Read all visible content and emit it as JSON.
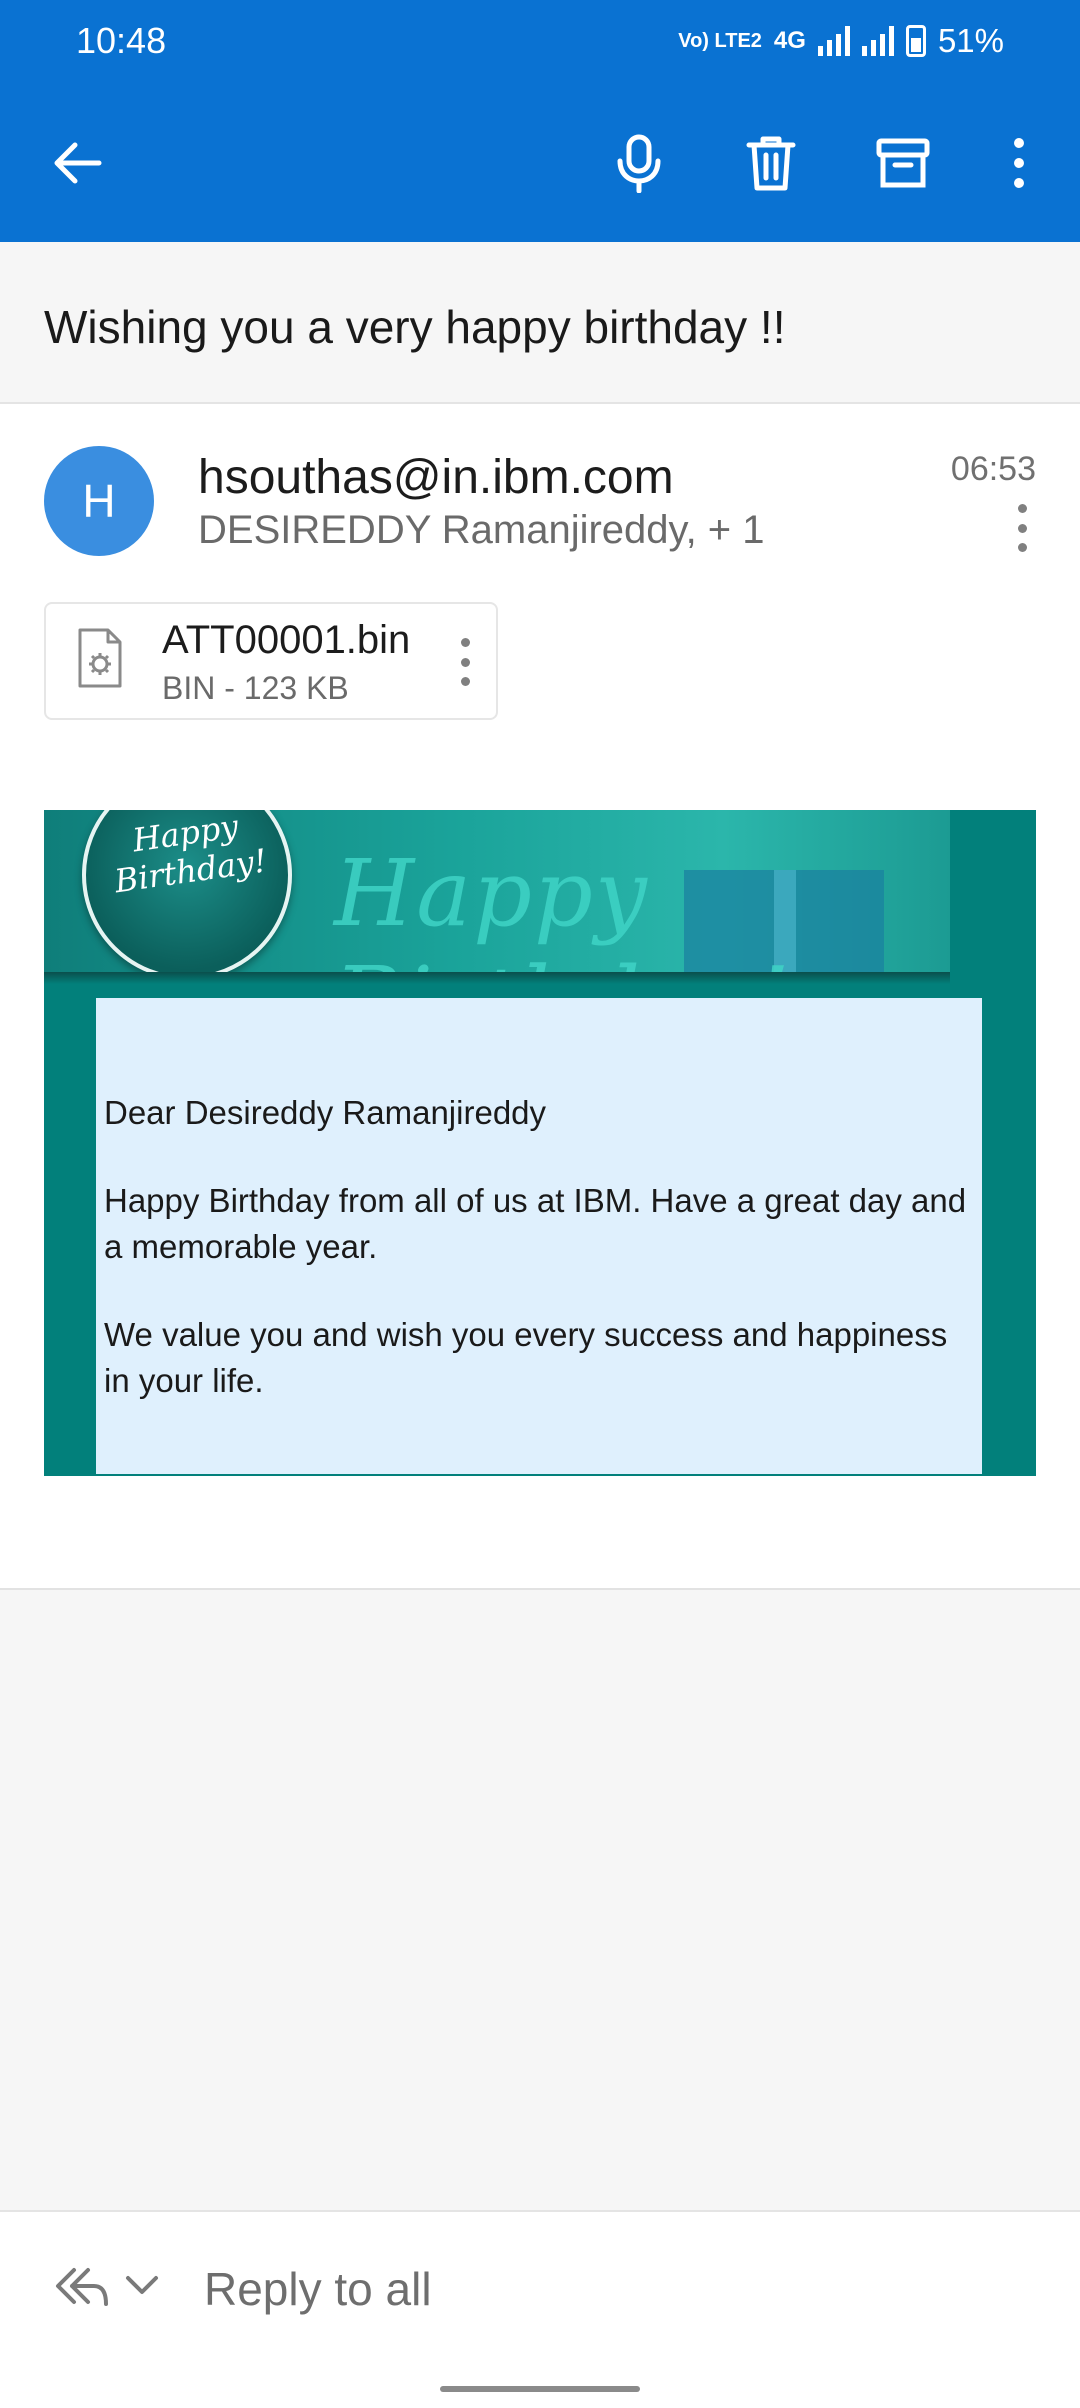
{
  "status_bar": {
    "time": "10:48",
    "network": "Vo) LTE2",
    "network_type": "4G",
    "battery": "51%"
  },
  "app_bar": {
    "icons": [
      "back-arrow-icon",
      "microphone-icon",
      "delete-icon",
      "archive-icon",
      "more-vert-icon"
    ]
  },
  "subject": "Wishing you a very happy birthday !!",
  "message": {
    "avatar_initial": "H",
    "sender": "hsouthas@in.ibm.com",
    "recipients": "DESIREDDY Ramanjireddy, + 1",
    "time": "06:53"
  },
  "attachment": {
    "name": "ATT00001.bin",
    "meta": "BIN - 123 KB"
  },
  "email_body": {
    "seal_text": "Happy Birthday!",
    "banner_text": "Happy Birthday!",
    "greeting": "Dear Desireddy Ramanjireddy",
    "paragraph1": "Happy Birthday from all of us at IBM. Have a great day and a memorable year.",
    "paragraph2": "We value you and wish you every success and happiness in your life."
  },
  "reply_bar": {
    "label": "Reply to all"
  },
  "colors": {
    "app_bar": "#0a72d2",
    "avatar": "#3a8ee0",
    "email_teal": "#02807b",
    "letter_bg": "#dff0fd"
  }
}
